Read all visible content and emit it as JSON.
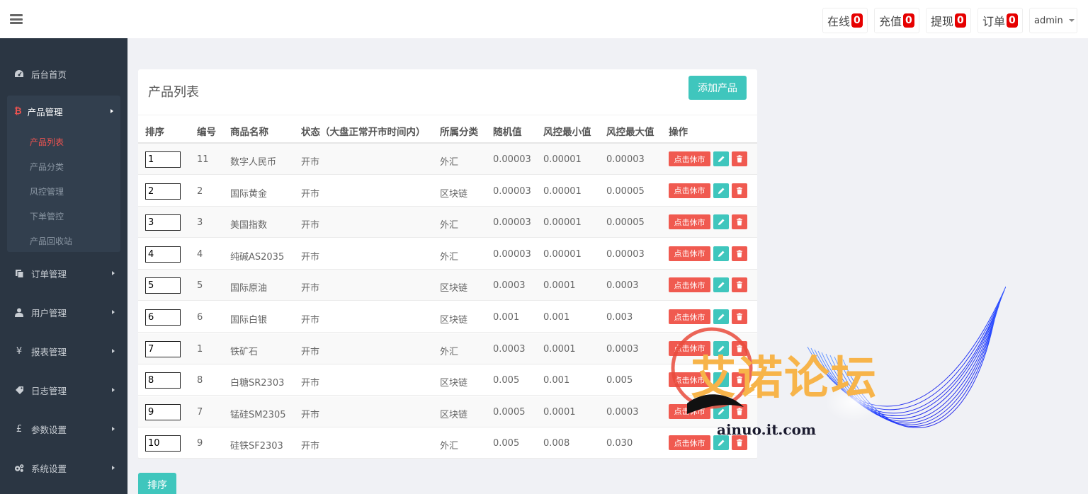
{
  "topbar": {
    "buttons": [
      {
        "label": "在线",
        "count": "0"
      },
      {
        "label": "充值",
        "count": "0"
      },
      {
        "label": "提现",
        "count": "0"
      },
      {
        "label": "订单",
        "count": "0"
      }
    ],
    "user": "admin"
  },
  "sidebar": {
    "home": "后台首页",
    "product_group": {
      "label": "产品管理",
      "items": [
        "产品列表",
        "产品分类",
        "风控管理",
        "下单管控",
        "产品回收站"
      ]
    },
    "items": [
      "订单管理",
      "用户管理",
      "报表管理",
      "日志管理",
      "参数设置",
      "系统设置"
    ]
  },
  "panel": {
    "title": "产品列表",
    "add_label": "添加产品",
    "sort_label": "排序",
    "headers": [
      "排序",
      "编号",
      "商品名称",
      "状态（大盘正常开市时间内）",
      "所属分类",
      "随机值",
      "风控最小值",
      "风控最大值",
      "操作"
    ],
    "rest_label": "点击休市",
    "rows": [
      {
        "sort": "1",
        "id": "11",
        "name": "数字人民币",
        "status": "开市",
        "category": "外汇",
        "random": "0.00003",
        "min": "0.00001",
        "max": "0.00003"
      },
      {
        "sort": "2",
        "id": "2",
        "name": "国际黄金",
        "status": "开市",
        "category": "区块链",
        "random": "0.00003",
        "min": "0.00001",
        "max": "0.00005"
      },
      {
        "sort": "3",
        "id": "3",
        "name": "美国指数",
        "status": "开市",
        "category": "外汇",
        "random": "0.00003",
        "min": "0.00001",
        "max": "0.00005"
      },
      {
        "sort": "4",
        "id": "4",
        "name": "纯碱AS2035",
        "status": "开市",
        "category": "外汇",
        "random": "0.00003",
        "min": "0.00001",
        "max": "0.00003"
      },
      {
        "sort": "5",
        "id": "5",
        "name": "国际原油",
        "status": "开市",
        "category": "区块链",
        "random": "0.0003",
        "min": "0.0001",
        "max": "0.0003"
      },
      {
        "sort": "6",
        "id": "6",
        "name": "国际白银",
        "status": "开市",
        "category": "区块链",
        "random": "0.001",
        "min": "0.001",
        "max": "0.003"
      },
      {
        "sort": "7",
        "id": "1",
        "name": "铁矿石",
        "status": "开市",
        "category": "外汇",
        "random": "0.0003",
        "min": "0.0001",
        "max": "0.0003"
      },
      {
        "sort": "8",
        "id": "8",
        "name": "白糖SR2303",
        "status": "开市",
        "category": "区块链",
        "random": "0.005",
        "min": "0.001",
        "max": "0.005"
      },
      {
        "sort": "9",
        "id": "7",
        "name": "锰硅SM2305",
        "status": "开市",
        "category": "区块链",
        "random": "0.0005",
        "min": "0.0001",
        "max": "0.0003"
      },
      {
        "sort": "10",
        "id": "9",
        "name": "硅铁SF2303",
        "status": "开市",
        "category": "外汇",
        "random": "0.005",
        "min": "0.008",
        "max": "0.030"
      }
    ]
  },
  "watermark": {
    "title": "艾诺论坛",
    "site": "ainuo.it.com"
  }
}
